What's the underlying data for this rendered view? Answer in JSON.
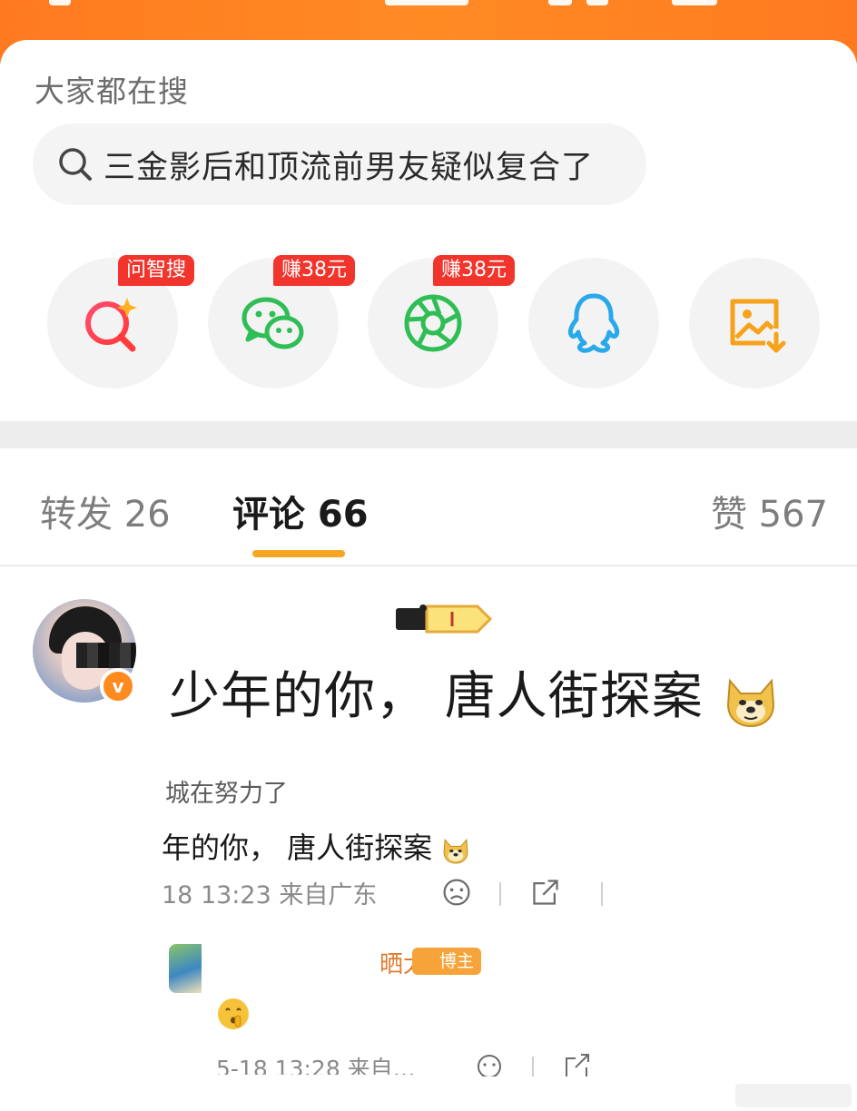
{
  "colors": {
    "accent": "#ff7a1f",
    "badge_red": "#f1352d",
    "tab_underline": "#f5a623",
    "username": "#e07b2e"
  },
  "trending": {
    "label": "大家都在搜",
    "query": "三金影后和顶流前男友疑似复合了"
  },
  "share_targets": [
    {
      "icon": "ai-search-icon",
      "badge": "问智搜"
    },
    {
      "icon": "wechat-icon",
      "badge": "赚38元"
    },
    {
      "icon": "moments-icon",
      "badge": "赚38元"
    },
    {
      "icon": "qq-icon",
      "badge": ""
    },
    {
      "icon": "save-image-icon",
      "badge": ""
    }
  ],
  "tabs": {
    "repost": "转发 26",
    "comment": "评论 66",
    "like": "赞 567"
  },
  "comment": {
    "text": "少年的你， 唐人街探案",
    "emoji": "doge-emoji",
    "quoted": {
      "user": "城在努力了",
      "text": "年的你， 唐人街探案",
      "meta": "18 13:23 来自广东"
    },
    "reply": {
      "user": "晒太阳",
      "badge": "博主",
      "emoji": "shush-emoji",
      "meta": "5-18 13:28 来自…"
    }
  }
}
